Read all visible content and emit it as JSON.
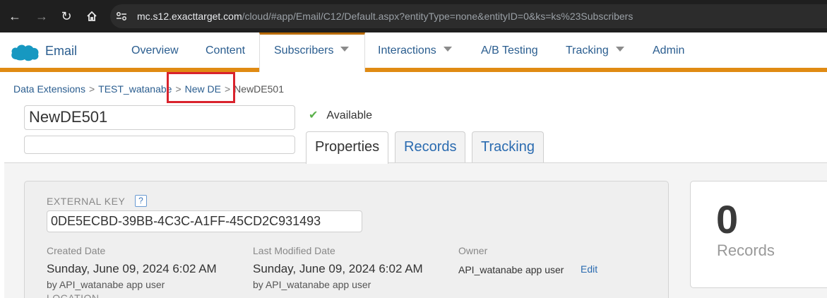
{
  "browser": {
    "url_host": "mc.s12.exacttarget.com",
    "url_path": "/cloud/#app/Email/C12/Default.aspx?entityType=none&entityID=0&ks=ks%23Subscribers"
  },
  "app": {
    "name": "Email",
    "accent_color": "#e08b13",
    "nav": [
      {
        "label": "Overview"
      },
      {
        "label": "Content"
      },
      {
        "label": "Subscribers"
      },
      {
        "label": "Interactions"
      },
      {
        "label": "A/B Testing"
      },
      {
        "label": "Tracking"
      },
      {
        "label": "Admin"
      }
    ]
  },
  "breadcrumb": {
    "items": [
      "Data Extensions",
      "TEST_watanabe",
      "New DE"
    ],
    "current": "NewDE501",
    "separator": ">"
  },
  "entity": {
    "name": "NewDE501",
    "description": "",
    "status": "Available"
  },
  "tabs": [
    {
      "label": "Properties"
    },
    {
      "label": "Records"
    },
    {
      "label": "Tracking"
    }
  ],
  "properties": {
    "external_key_label": "EXTERNAL KEY",
    "help_label": "?",
    "external_key": "0DE5ECBD-39BB-4C3C-A1FF-45CD2C931493",
    "created_label": "Created Date",
    "created_value": "Sunday, June 09, 2024 6:02 AM",
    "created_by": "by API_watanabe app user",
    "modified_label": "Last Modified Date",
    "modified_value": "Sunday, June 09, 2024 6:02 AM",
    "modified_by": "by API_watanabe app user",
    "owner_label": "Owner",
    "owner_value": "API_watanabe app user",
    "edit_label": "Edit",
    "location_label": "LOCATION"
  },
  "records_card": {
    "count": "0",
    "label": "Records"
  }
}
